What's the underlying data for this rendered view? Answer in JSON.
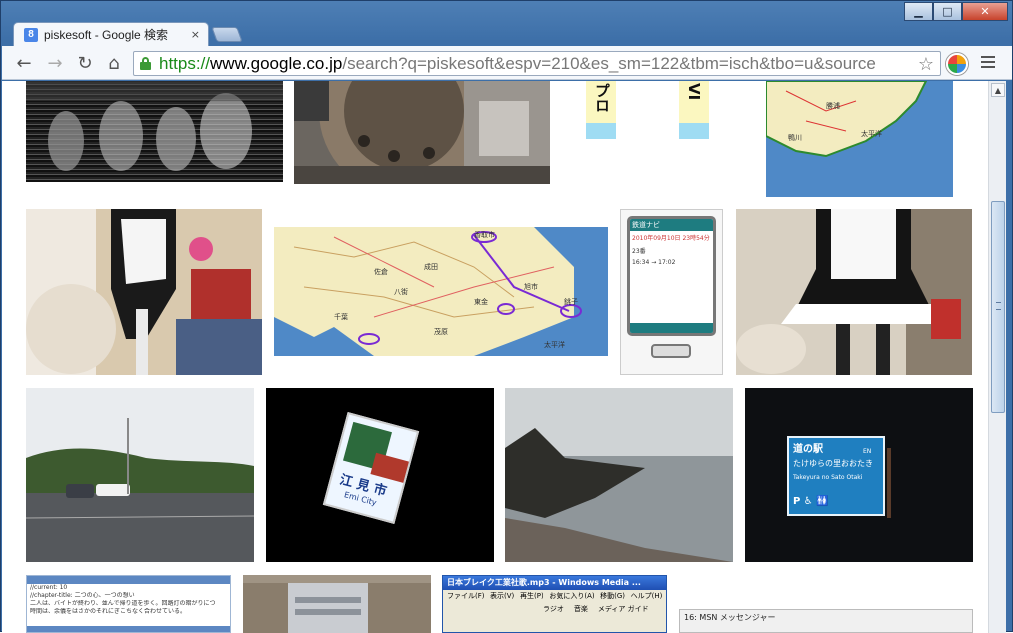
{
  "window": {
    "minimize_glyph": "▁",
    "maximize_glyph": "□",
    "close_glyph": "✕"
  },
  "tab": {
    "favicon_letter": "8",
    "title": "piskesoft - Google 検索",
    "close_glyph": "×"
  },
  "toolbar": {
    "back_glyph": "←",
    "forward_glyph": "→",
    "reload_glyph": "↻",
    "home_glyph": "⌂",
    "star_glyph": "☆",
    "url_scheme": "https://",
    "url_host": "www.google.co.jp",
    "url_path": "/search?q=piskesoft&espv=210&es_sm=122&tbm=isch&tbo=u&source"
  },
  "results": {
    "sign_text_vertical_1": "プロ",
    "sign_text_vertical_2": "VI",
    "map_labels": [
      "香取市",
      "成田",
      "千葉",
      "東金",
      "茂原",
      "太平洋",
      "銚子",
      "旭市",
      "八街",
      "佐倉"
    ],
    "map2_labels": [
      "鴨川",
      "太平洋",
      "勝浦"
    ],
    "michinoeki_title": "道の駅",
    "michinoeki_en": "EN",
    "michinoeki_sub": "たけゆらの里おおたき",
    "michinoeki_romaji": "Takeyura no Sato Otaki",
    "michinoeki_icons": "P ♿ 🚻",
    "station_sign_text": "江 見 市",
    "station_sign_romaji": "Emi City",
    "phone_header": "鉄道ナビ",
    "phone_lines": [
      "2010年09月10日 23時54分",
      "23番",
      "16:34 → 17:02"
    ],
    "mediaplayer_title": "日本ブレイク工業社歌.mp3 - Windows Media ...",
    "mediaplayer_menu": [
      "ファイル(F)",
      "表示(V)",
      "再生(P)",
      "お気に入り(A)",
      "移動(G)",
      "ヘルプ(H)"
    ],
    "mediaplayer_toolbar": [
      "ラジオ",
      "音楽",
      "メディア ガイド"
    ],
    "msn_title": "16: MSN メッセンジャー",
    "editor_lines": [
      "//current: 10",
      "//chapter-title: 二つの心、一つの想い",
      "二人は、バイトが終わり、並んで帰り道を歩く。回路灯の暗がりにつ",
      "時間は、余儀をはさかのそれにぎこちなく合わせている。"
    ]
  },
  "colors": {
    "chrome_frame": "#3d6fa8",
    "url_green": "#1a8a1a",
    "map_water": "#4f89c7",
    "map_land": "#f3ecc0"
  }
}
